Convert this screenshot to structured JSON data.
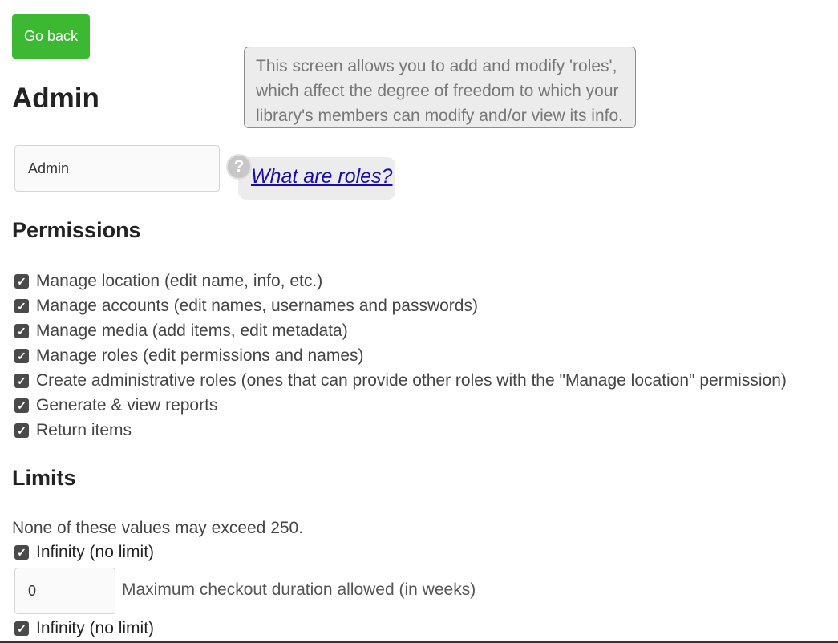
{
  "nav": {
    "go_back_label": "Go back"
  },
  "page": {
    "title": "Admin"
  },
  "tooltip": {
    "text": "This screen allows you to add and modify 'roles', which affect the degree of freedom to which your library's members can modify and/or view its info."
  },
  "role_name": {
    "value": "Admin"
  },
  "help": {
    "icon_glyph": "?",
    "link_label": "What are roles?"
  },
  "permissions": {
    "title": "Permissions",
    "items": [
      {
        "label": "Manage location (edit name, info, etc.)",
        "checked": true
      },
      {
        "label": "Manage accounts (edit names, usernames and passwords)",
        "checked": true
      },
      {
        "label": "Manage media (add items, edit metadata)",
        "checked": true
      },
      {
        "label": "Manage roles (edit permissions and names)",
        "checked": true
      },
      {
        "label": "Create administrative roles (ones that can provide other roles with the \"Manage location\" permission)",
        "checked": true
      },
      {
        "label": "Generate & view reports",
        "checked": true
      },
      {
        "label": "Return items",
        "checked": true
      }
    ]
  },
  "limits": {
    "title": "Limits",
    "note": "None of these values may exceed 250.",
    "infinity_label": "Infinity (no limit)",
    "checkout_duration": {
      "value": "0",
      "label": "Maximum checkout duration allowed (in weeks)"
    },
    "second_infinity_label": "Infinity (no limit)"
  },
  "colors": {
    "accent": "#3cb832",
    "tooltip_bg": "#ececec",
    "link": "#1a0dab"
  },
  "icons": {
    "checkbox": "checkmark-icon",
    "help": "question-mark-icon"
  }
}
